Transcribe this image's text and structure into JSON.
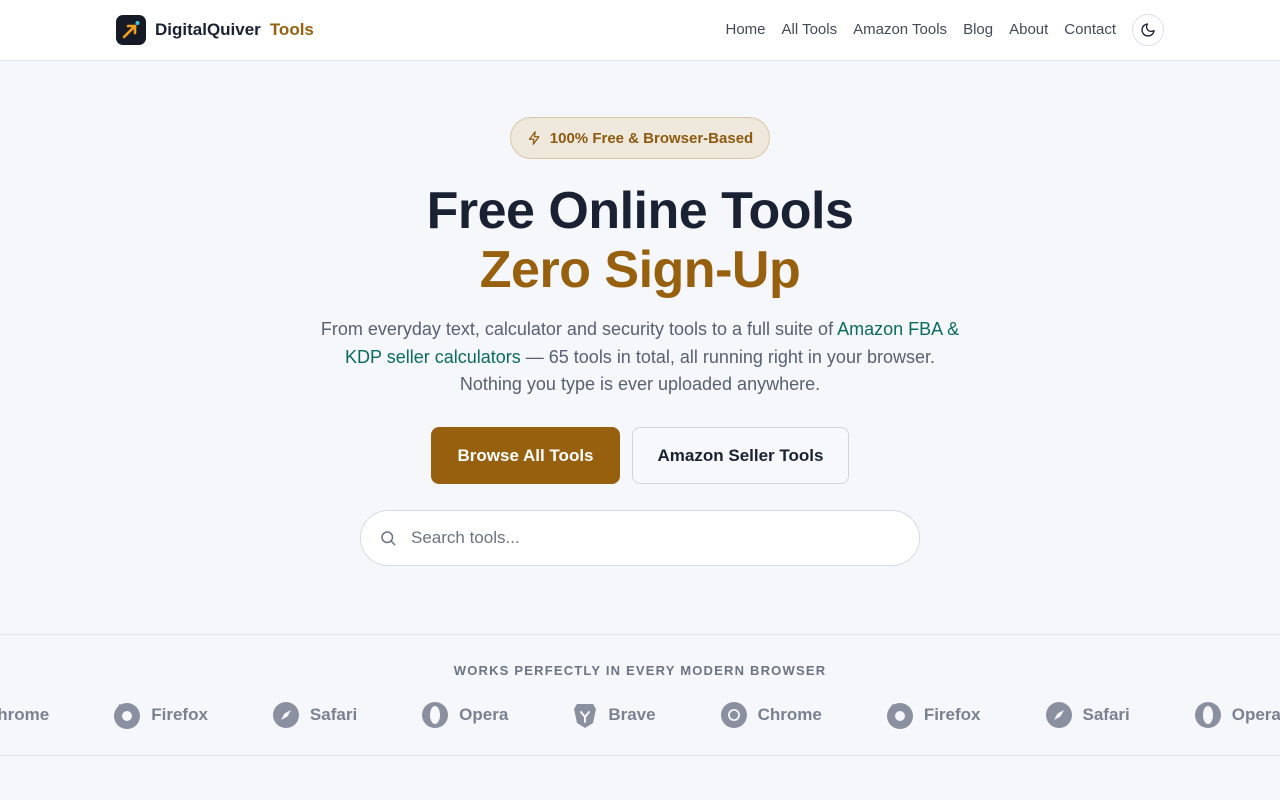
{
  "header": {
    "brand": "DigitalQuiver",
    "brand_accent": "Tools",
    "nav": [
      {
        "label": "Home"
      },
      {
        "label": "All Tools"
      },
      {
        "label": "Amazon Tools"
      },
      {
        "label": "Blog"
      },
      {
        "label": "About"
      },
      {
        "label": "Contact"
      }
    ],
    "theme_icon": "moon-icon"
  },
  "hero": {
    "badge": "100% Free & Browser-Based",
    "badge_icon": "lightning-icon",
    "title_line1": "Free Online Tools",
    "title_line2": "Zero Sign-Up",
    "lead_before": "From everyday text, calculator and security tools to a full suite of ",
    "lead_link": "Amazon FBA & KDP seller calculators",
    "lead_after": " — 65 tools in total, all running right in your browser. Nothing you type is ever uploaded anywhere.",
    "primary_button": "Browse All Tools",
    "secondary_button": "Amazon Seller Tools",
    "search_placeholder": "Search tools..."
  },
  "browsers": {
    "title": "WORKS PERFECTLY IN EVERY MODERN BROWSER",
    "items": [
      {
        "name": "Chrome",
        "icon": "chrome-icon"
      },
      {
        "name": "Firefox",
        "icon": "firefox-icon"
      },
      {
        "name": "Safari",
        "icon": "safari-icon"
      },
      {
        "name": "Opera",
        "icon": "opera-icon"
      },
      {
        "name": "Brave",
        "icon": "brave-icon"
      },
      {
        "name": "Chrome",
        "icon": "chrome-icon"
      },
      {
        "name": "Firefox",
        "icon": "firefox-icon"
      },
      {
        "name": "Safari",
        "icon": "safari-icon"
      },
      {
        "name": "Opera",
        "icon": "opera-icon"
      }
    ]
  },
  "colors": {
    "accent": "#97600f",
    "dark": "#1a2133",
    "link": "#0c6b5f",
    "badge_bg": "#efe8dd"
  }
}
